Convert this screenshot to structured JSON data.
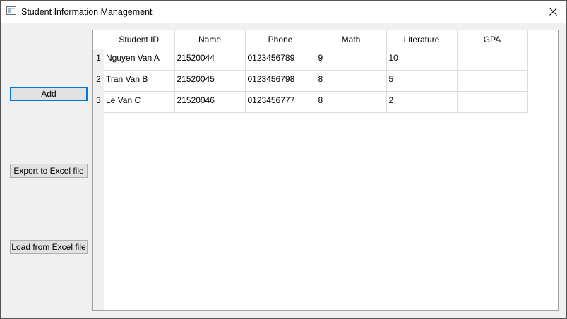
{
  "window": {
    "title": "Student Information Management"
  },
  "buttons": {
    "add": "Add",
    "export": "Export to Excel file",
    "load": "Load from Excel file"
  },
  "table": {
    "columns": [
      "Student ID",
      "Name",
      "Phone",
      "Math",
      "Literature",
      "GPA"
    ],
    "rows": [
      {
        "num": "1",
        "cells": [
          "Nguyen Van A",
          "21520044",
          "0123456789",
          "9",
          "10",
          ""
        ]
      },
      {
        "num": "2",
        "cells": [
          "Tran Van B",
          "21520045",
          "0123456798",
          "8",
          "5",
          ""
        ]
      },
      {
        "num": "3",
        "cells": [
          "Le Van C",
          "21520046",
          "0123456777",
          "8",
          "2",
          ""
        ]
      }
    ]
  },
  "colors": {
    "default_button_border": "#0078d7",
    "button_face": "#e1e1e1",
    "window_face": "#f0f0f0"
  }
}
